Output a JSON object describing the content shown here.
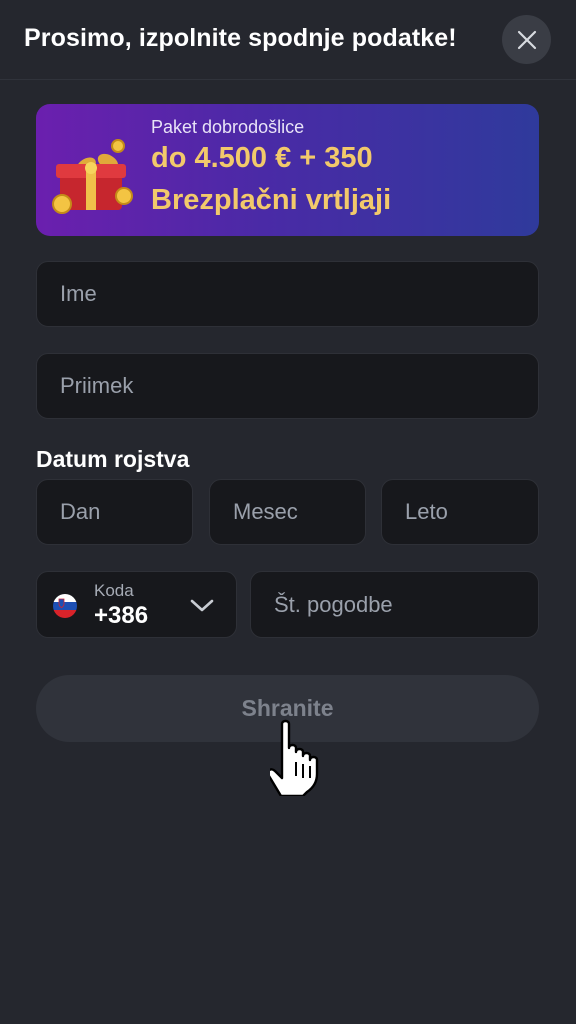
{
  "header": {
    "title": "Prosimo, izpolnite spodnje podatke!",
    "close_icon": "close-icon"
  },
  "banner": {
    "subtitle": "Paket dobrodošlice",
    "line1": "do 4.500 € + 350",
    "line2": "Brezplačni vrtljaji",
    "icon": "gift-box-with-coins",
    "accent_color": "#f2c96b"
  },
  "form": {
    "first_name_placeholder": "Ime",
    "last_name_placeholder": "Priimek",
    "birth_date": {
      "label": "Datum rojstva",
      "day_placeholder": "Dan",
      "month_placeholder": "Mesec",
      "year_placeholder": "Leto"
    },
    "phone": {
      "code_label": "Koda",
      "code_value": "+386",
      "flag": "slovenia-flag",
      "number_placeholder": "Št. pogodbe"
    },
    "save_label": "Shranite"
  },
  "colors": {
    "background": "#25272e",
    "field_background": "#17181c",
    "button_disabled": "#30333b"
  }
}
